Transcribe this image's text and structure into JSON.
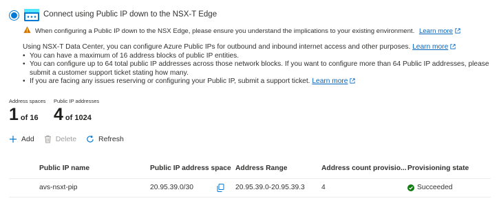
{
  "option": {
    "label": "Connect using Public IP down to the NSX-T Edge",
    "selected": true
  },
  "warning": {
    "text": "When configuring a Public IP down to the NSX Edge, please ensure you understand the implications to your existing environment.",
    "link": "Learn more"
  },
  "info": {
    "intro": "Using NSX-T Data Center, you can configure Azure Public IPs for outbound and inbound internet access and other purposes.",
    "intro_link": "Learn more",
    "bullets": [
      "You can have a maximum of 16 address blocks of public IP entities.",
      "You can configure up to 64 total public IP addresses across those network blocks. If you want to configure more than 64 Public IP addresses, please submit a customer support ticket stating how many.",
      "If you are facing any issues reserving or configuring your Public IP, submit a support ticket."
    ],
    "last_link": "Learn more"
  },
  "stats": {
    "address_spaces": {
      "label": "Address spaces",
      "value": "1",
      "of": "of 16"
    },
    "public_ips": {
      "label": "Public IP addresses",
      "value": "4",
      "of": "of 1024"
    }
  },
  "toolbar": {
    "add": "Add",
    "delete": "Delete",
    "refresh": "Refresh"
  },
  "table": {
    "headers": [
      "Public IP name",
      "Public IP address space",
      "Address Range",
      "Address count provisio...",
      "Provisioning state"
    ],
    "rows": [
      [
        "avs-nsxt-pip",
        "20.95.39.0/30",
        "20.95.39.0-20.95.39.3",
        "4",
        "Succeeded"
      ]
    ]
  },
  "colors": {
    "accent": "#0078d4",
    "warning": "#d47500",
    "success": "#107c10"
  }
}
